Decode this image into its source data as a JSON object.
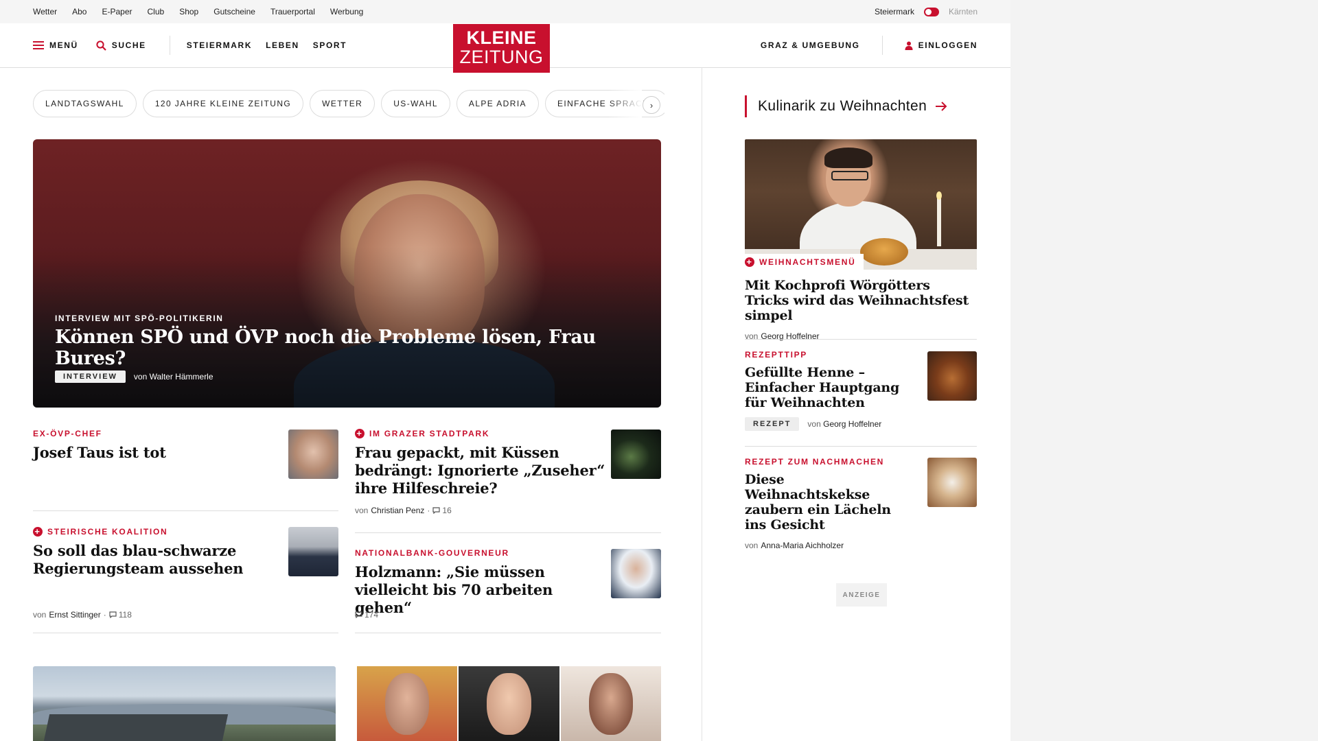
{
  "util_nav": [
    "Wetter",
    "Abo",
    "E-Paper",
    "Club",
    "Shop",
    "Gutscheine",
    "Trauerportal",
    "Werbung"
  ],
  "region_switch": {
    "left": "Steiermark",
    "right": "Kärnten"
  },
  "header": {
    "menu_label": "MENÜ",
    "search_label": "SUCHE",
    "nav": [
      "STEIERMARK",
      "LEBEN",
      "SPORT"
    ],
    "logo_line1": "KLEINE",
    "logo_line2": "ZEITUNG",
    "region_label": "GRAZ & UMGEBUNG",
    "login_label": "EINLOGGEN"
  },
  "topics": [
    "LANDTAGSWAHL",
    "120 JAHRE KLEINE ZEITUNG",
    "WETTER",
    "US-WAHL",
    "ALPE ADRIA",
    "EINFACHE SPRACHE"
  ],
  "hero": {
    "kicker": "INTERVIEW MIT SPÖ-POLITIKERIN",
    "title": "Können SPÖ und ÖVP noch die Probleme lösen, Frau Bures?",
    "badge": "INTERVIEW",
    "byline_prefix": "von",
    "author": "Walter Hämmerle"
  },
  "articles": [
    {
      "kicker": "EX-ÖVP-CHEF",
      "title": "Josef Taus ist tot",
      "premium": false
    },
    {
      "kicker": "IM GRAZER STADTPARK",
      "title": "Frau gepackt, mit Küssen bedrängt: Ignorierte „Zuseher“ ihre Hilfeschreie?",
      "premium": true,
      "byline_prefix": "von",
      "author": "Christian Penz",
      "comments": "16"
    },
    {
      "kicker": "STEIRISCHE KOALITION",
      "title": "So soll das blau-schwarze Regierungsteam aussehen",
      "premium": true,
      "byline_prefix": "von",
      "author": "Ernst Sittinger",
      "comments": "118"
    },
    {
      "kicker": "NATIONALBANK-GOUVERNEUR",
      "title": "Holzmann: „Sie müssen vielleicht bis 70 arbeiten gehen“",
      "premium": false,
      "comments": "174"
    }
  ],
  "sidebar": {
    "heading": "Kulinarik zu Weihnachten",
    "feature": {
      "kicker": "WEIHNACHTSMENÜ",
      "title": "Mit Kochprofi Wörgötters Tricks wird das Weihnachtsfest simpel",
      "byline_prefix": "von",
      "author": "Georg Hoffelner"
    },
    "items": [
      {
        "kicker": "REZEPTTIPP",
        "title": "Gefüllte Henne – Einfacher Hauptgang für Weihnachten",
        "badge": "REZEPT",
        "byline_prefix": "von",
        "author": "Georg Hoffelner"
      },
      {
        "kicker": "REZEPT ZUM NACHMACHEN",
        "title": "Diese Weihnachtskekse zaubern ein Lächeln ins Gesicht",
        "byline_prefix": "von",
        "author": "Anna-Maria Aichholzer"
      }
    ],
    "ad_label": "ANZEIGE"
  },
  "colors": {
    "brand": "#c8102e",
    "text": "#111111",
    "muted": "#666666",
    "divider": "#dddddd"
  },
  "icons": [
    "hamburger-icon",
    "search-icon",
    "user-icon",
    "arrow-right-icon",
    "plus-icon",
    "comment-icon",
    "chevron-right-icon"
  ]
}
